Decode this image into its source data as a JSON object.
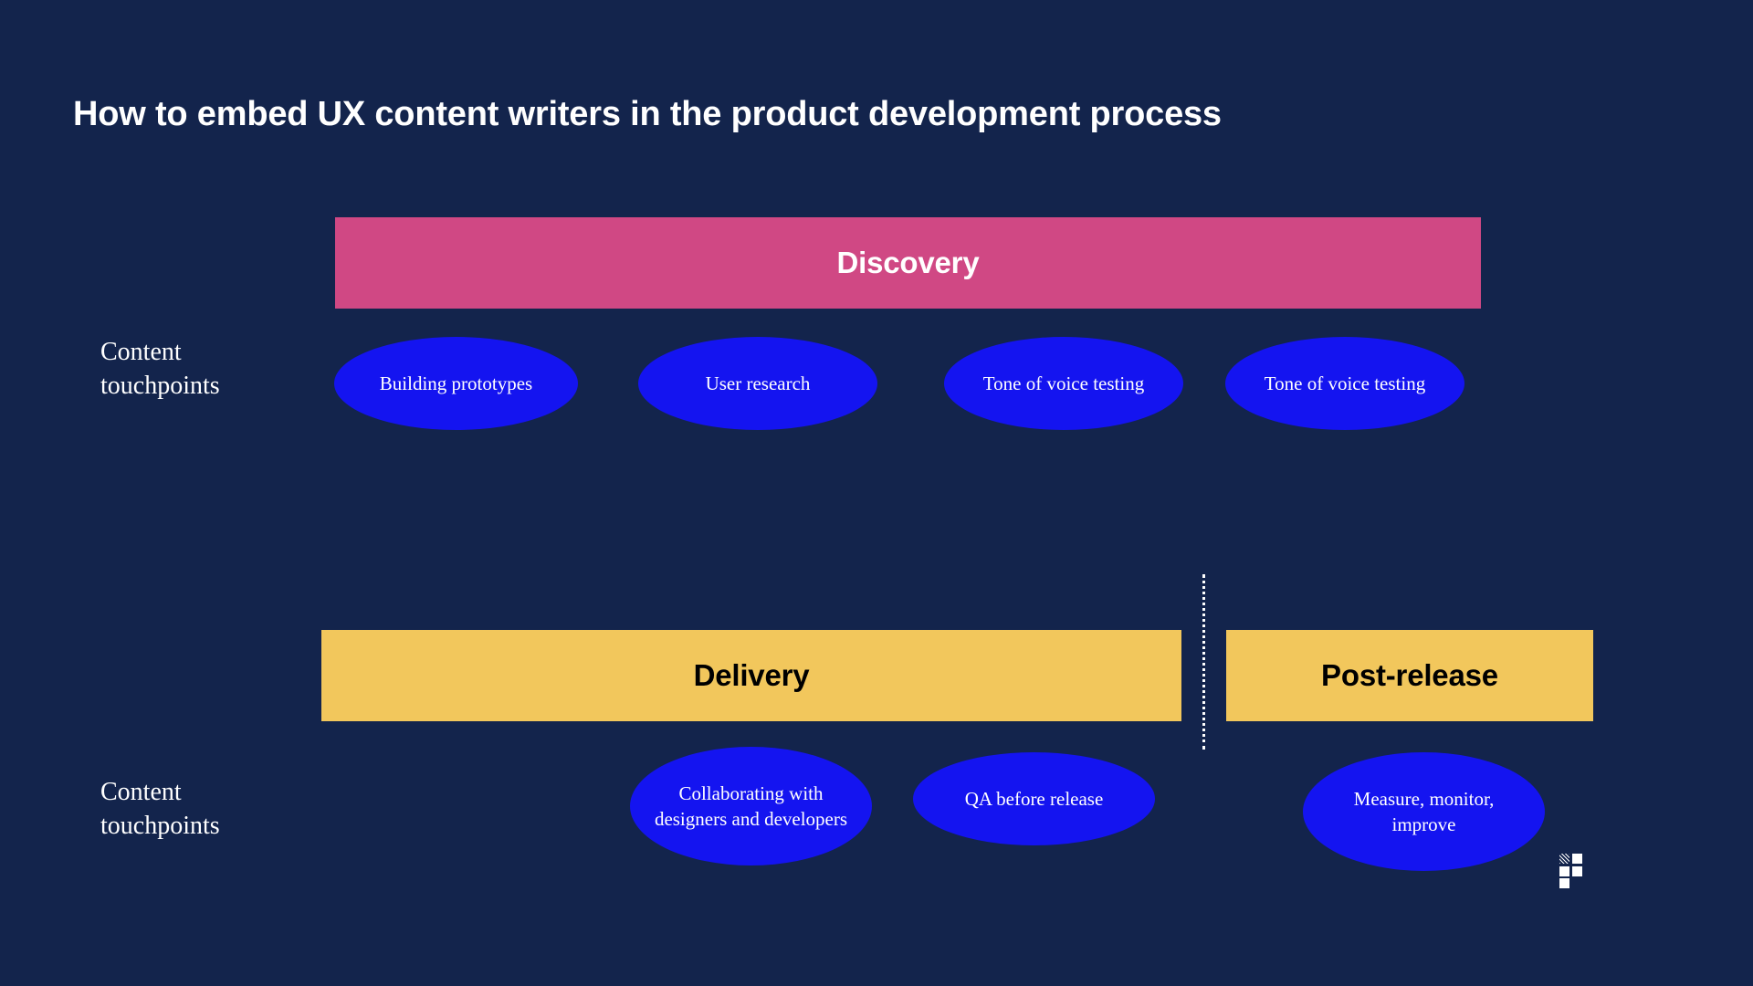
{
  "slide": {
    "title": "How to embed UX content writers in the product development process",
    "background_color": "#13244c"
  },
  "colors": {
    "background": "#13244c",
    "discovery_banner": "#d04884",
    "delivery_banner": "#f2c75c",
    "postrelease_banner": "#f2c75c",
    "touchpoint_fill": "#1414f0",
    "title_text": "#ffffff",
    "banner_text_light": "#ffffff",
    "banner_text_dark": "#000000"
  },
  "rows": [
    {
      "label": "Content touchpoints",
      "phases": [
        {
          "name": "Discovery"
        }
      ],
      "touchpoints": [
        {
          "label": "Building prototypes"
        },
        {
          "label": "User research"
        },
        {
          "label": "Tone of voice testing"
        },
        {
          "label": "Tone of voice testing"
        }
      ]
    },
    {
      "label": "Content touchpoints",
      "phases": [
        {
          "name": "Delivery"
        },
        {
          "name": "Post-release"
        }
      ],
      "touchpoints": [
        {
          "label": "Collaborating with designers and developers"
        },
        {
          "label": "QA before release"
        },
        {
          "label": "Measure, monitor, improve"
        }
      ]
    }
  ],
  "logo": {
    "name": "grid-squares-logo"
  }
}
